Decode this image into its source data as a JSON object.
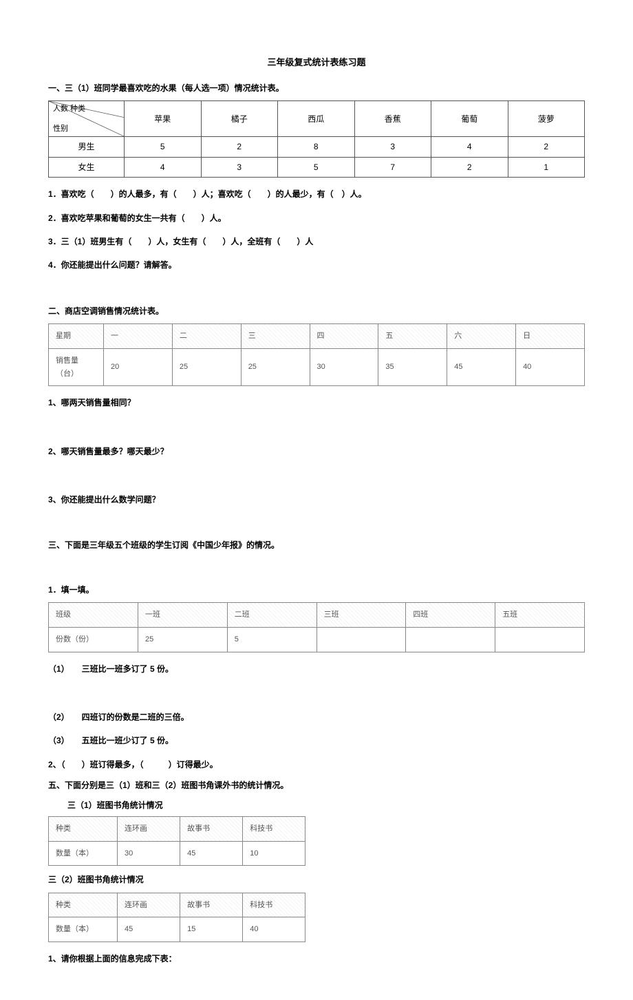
{
  "title": "三年级复式统计表练习题",
  "section1": {
    "heading": "一、三（1）班同学最喜欢吃的水果（每人选一项）情况统计表。",
    "cornerTop": "人数 种类",
    "cornerBottom": "性别",
    "cols": [
      "苹果",
      "橘子",
      "西瓜",
      "香蕉",
      "葡萄",
      "菠萝"
    ],
    "rows": [
      {
        "label": "男生",
        "vals": [
          "5",
          "2",
          "8",
          "3",
          "4",
          "2"
        ]
      },
      {
        "label": "女生",
        "vals": [
          "4",
          "3",
          "5",
          "7",
          "2",
          "1"
        ]
      }
    ],
    "q1": "1．喜欢吃（　　）的人最多，有（　　）人；喜欢吃（　　）的人最少，有（　）人。",
    "q2": "2．喜欢吃苹果和葡萄的女生一共有（　　）人。",
    "q3": "3．三（1）班男生有（　　）人，女生有（　　）人，全班有（　　）人",
    "q4": "4．你还能提出什么问题？请解答。"
  },
  "section2": {
    "heading": "二、商店空调销售情况统计表。",
    "row1": [
      "星期",
      "一",
      "二",
      "三",
      "四",
      "五",
      "六",
      "日"
    ],
    "row2": [
      "销售量（台）",
      "20",
      "25",
      "25",
      "30",
      "35",
      "45",
      "40"
    ],
    "q1": "1、哪两天销售量相同？",
    "q2": "2、哪天销售量最多？哪天最少？",
    "q3": "3、你还能提出什么数学问题？"
  },
  "section3": {
    "heading": "三、下面是三年级五个班级的学生订阅《中国少年报》的情况。",
    "sub": "1．填一填。",
    "row1": [
      "班级",
      "一班",
      "二班",
      "三班",
      "四班",
      "五班"
    ],
    "row2": [
      "份数（份）",
      "25",
      "5",
      "",
      "",
      ""
    ],
    "c1": "（1）　　三班比一班多订了 5 份。",
    "c2": "（2）　　四班订的份数是二班的三倍。",
    "c3": "（3）　　五班比一班少订了 5 份。",
    "q2": "2、（　　）班订得最多，（　　　）订得最少。"
  },
  "section5": {
    "heading": "五、下面分别是三（1）班和三（2）班图书角课外书的统计情况。",
    "t1title": "三（1）班图书角统计情况",
    "t1r1": [
      "种类",
      "连环画",
      "故事书",
      "科技书"
    ],
    "t1r2": [
      "数量（本）",
      "30",
      "45",
      "10"
    ],
    "t2title": "三（2）班图书角统计情况",
    "t2r1": [
      "种类",
      "连环画",
      "故事书",
      "科技书"
    ],
    "t2r2": [
      "数量（本）",
      "45",
      "15",
      "40"
    ],
    "q1": "1、请你根据上面的信息完成下表："
  }
}
